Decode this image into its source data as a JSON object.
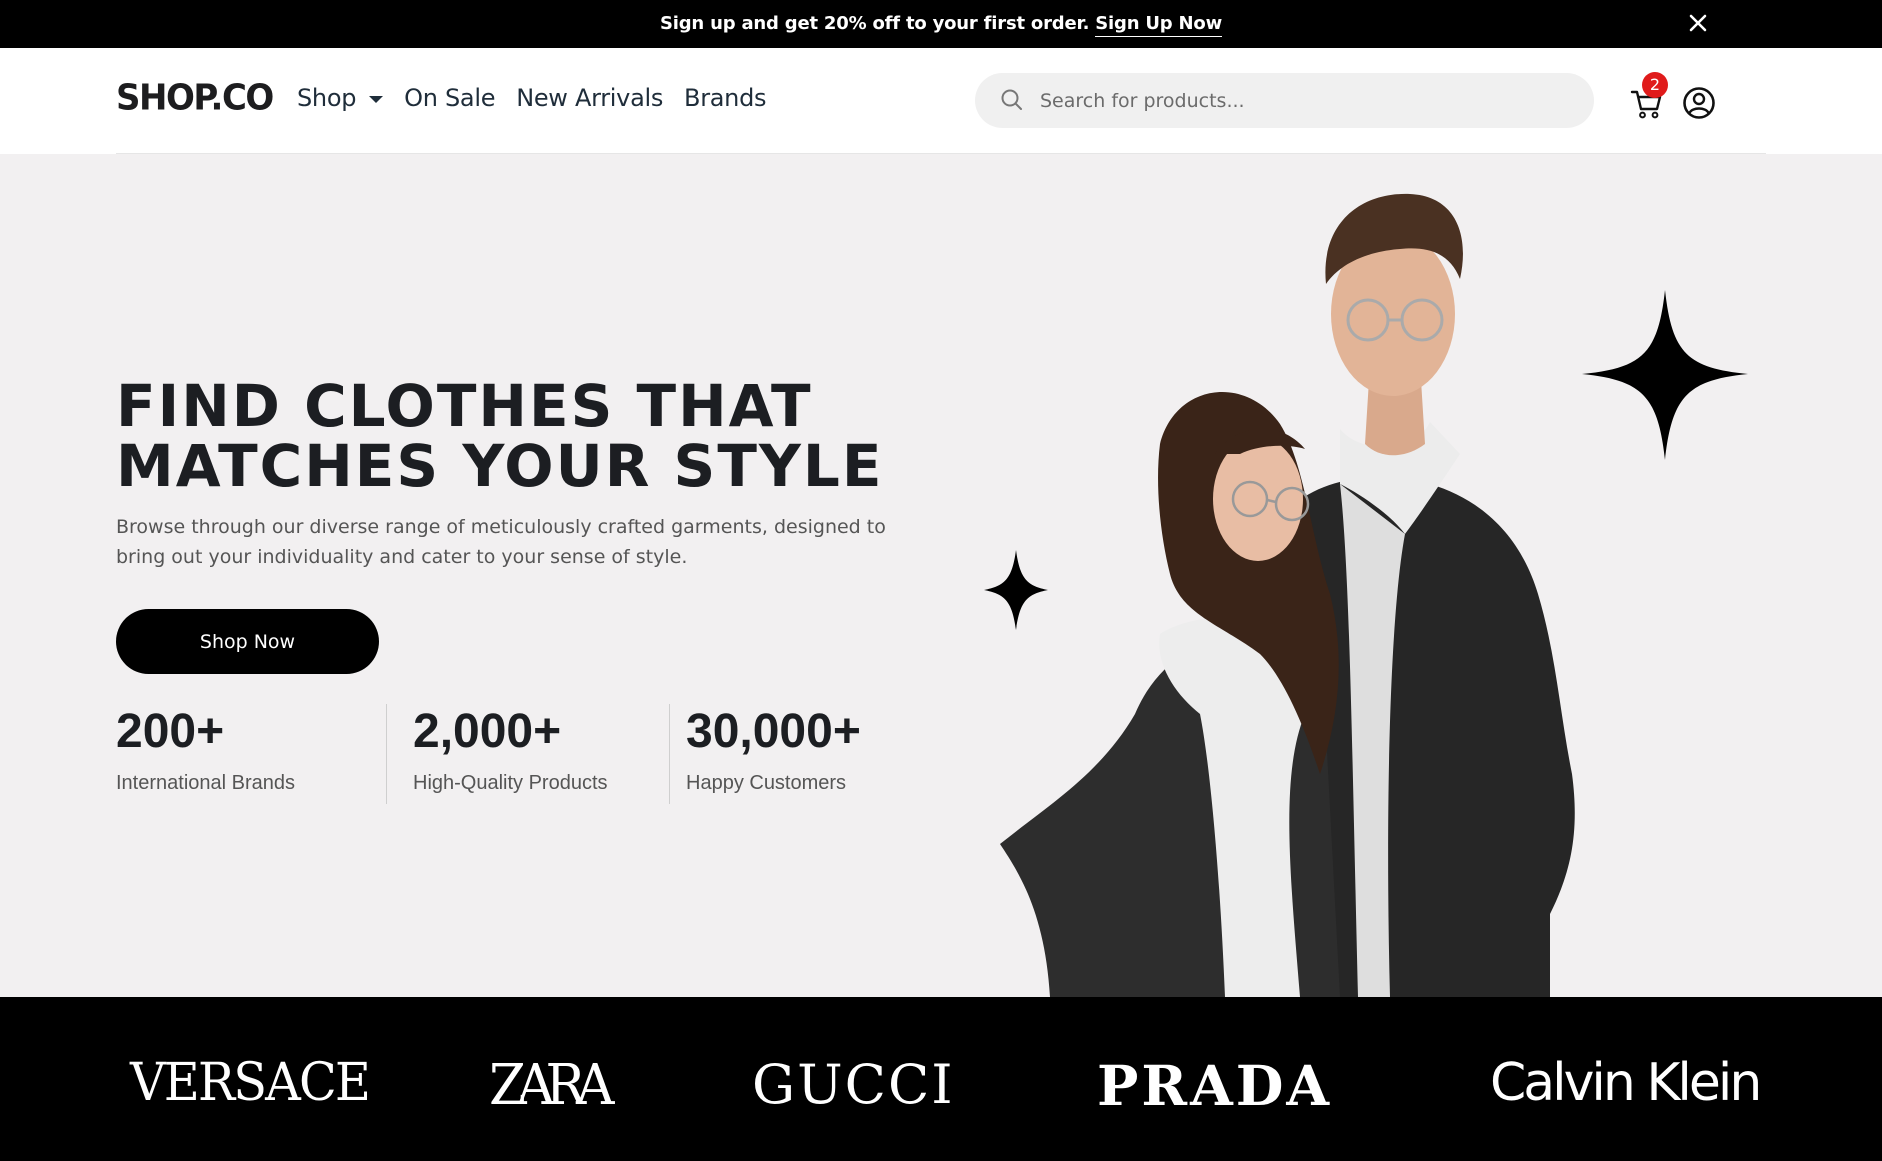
{
  "promo": {
    "text": "Sign up and get 20% off to your first order. ",
    "link": "Sign Up Now"
  },
  "header": {
    "logo": "SHOP.CO",
    "nav": [
      "Shop",
      "On Sale",
      "New Arrivals",
      "Brands"
    ],
    "search_placeholder": "Search for products...",
    "cart_count": "2"
  },
  "hero": {
    "title_line1": "FIND CLOTHES THAT",
    "title_line2": "MATCHES YOUR STYLE",
    "subtitle": "Browse through our diverse range of meticulously crafted garments, designed to bring out your individuality and cater to your sense of style.",
    "cta": "Shop Now",
    "stats": [
      {
        "value": "200+",
        "label": "International Brands"
      },
      {
        "value": "2,000+",
        "label": "High-Quality Products"
      },
      {
        "value": "30,000+",
        "label": "Happy Customers"
      }
    ]
  },
  "brands": [
    "VERSACE",
    "ZARA",
    "GUCCI",
    "PRADA",
    "Calvin Klein"
  ],
  "colors": {
    "promo_bg": "#000000",
    "hero_bg": "#f2f0f1",
    "badge": "#e01b1b",
    "brand_strip_bg": "#000000"
  },
  "icons": {
    "close": "close-icon",
    "search": "search-icon",
    "cart": "cart-icon",
    "user": "user-circle-icon",
    "sparkle": "sparkle-icon"
  }
}
